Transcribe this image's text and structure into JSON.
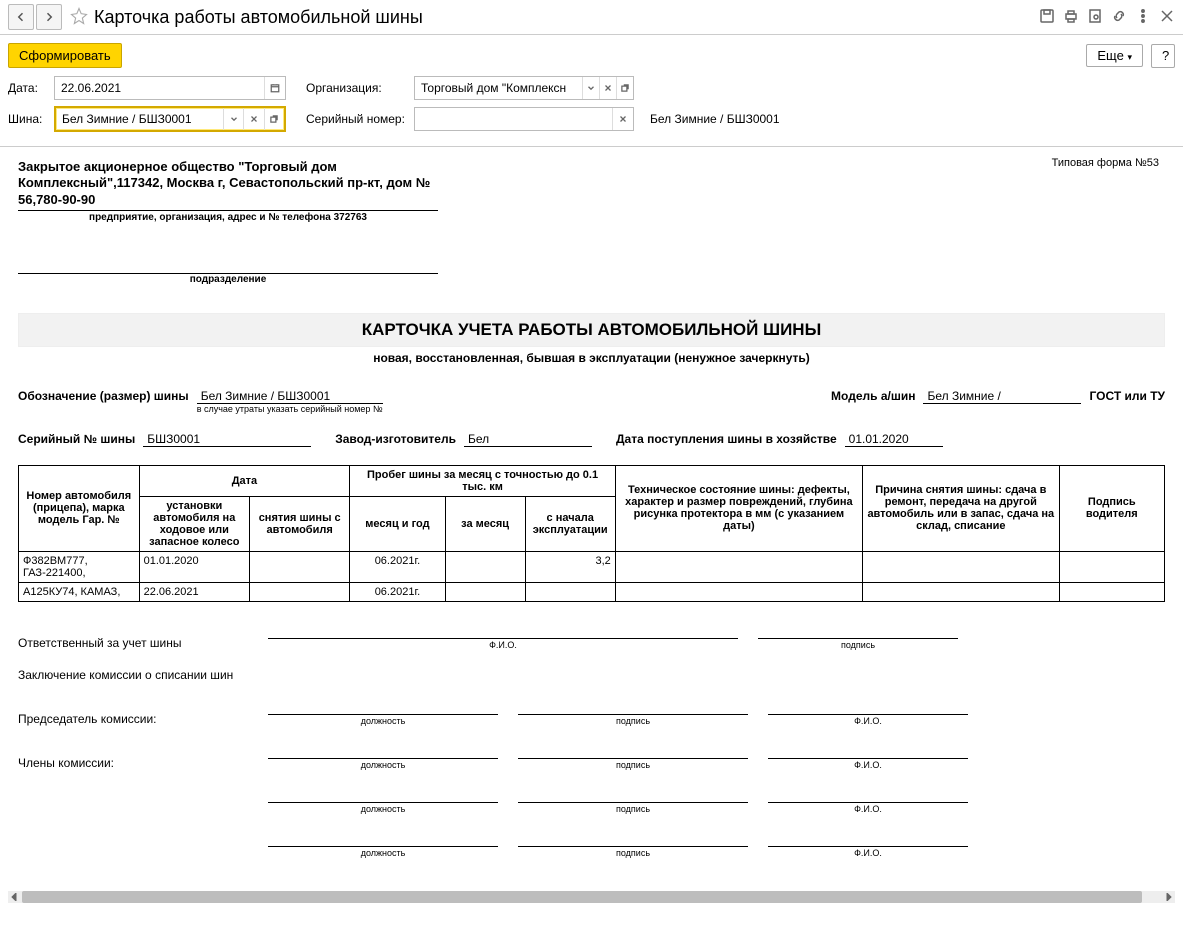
{
  "titlebar": {
    "title": "Карточка работы автомобильной шины"
  },
  "toolbar": {
    "generate": "Сформировать",
    "more": "Еще",
    "help": "?"
  },
  "params": {
    "date_label": "Дата:",
    "date_value": "22.06.2021",
    "org_label": "Организация:",
    "org_value": "Торговый дом \"Комплексн",
    "tyre_label": "Шина:",
    "tyre_value": "Бел Зимние / БШЗ0001",
    "serial_label": "Серийный номер:",
    "serial_value": "",
    "serial_display": "Бел Зимние / БШЗ0001"
  },
  "report": {
    "form_no": "Типовая форма №53",
    "org_name": "Закрытое акционерное общество \"Торговый дом Комплексный\",117342, Москва г, Севастопольский пр-кт, дом № 56,780-90-90",
    "org_sub": "предприятие, организация, адрес и № телефона 372763",
    "division_sub": "подразделение",
    "doc_title": "КАРТОЧКА УЧЕТА РАБОТЫ АВТОМОБИЛЬНОЙ ШИНЫ",
    "doc_sub": "новая, восстановленная, бывшая в эксплуатации (ненужное зачеркнуть)",
    "meta": {
      "size_label": "Обозначение (размер) шины",
      "size_value": "Бел Зимние / БШЗ0001",
      "size_note": "в случае утраты указать серийный номер №",
      "model_label": "Модель а/шин",
      "model_value": "Бел Зимние /",
      "gost_label": "ГОСТ или ТУ",
      "serial_label": "Серийный № шины",
      "serial_value": "БШЗ0001",
      "plant_label": "Завод-изготовитель",
      "plant_value": "Бел",
      "arrival_label": "Дата поступления шины в хозяйстве",
      "arrival_value": "01.01.2020"
    },
    "table": {
      "h_vehicle": "Номер автомобиля (прицепа), марка модель Гар. №",
      "h_date": "Дата",
      "h_install": "установки автомобиля на ходовое или запасное колесо",
      "h_remove": "снятия шины с автомобиля",
      "h_run": "Пробег шины за месяц с точностью до 0.1 тыс. км",
      "h_month": "месяц и год",
      "h_permonth": "за месяц",
      "h_fromstart": "с начала эксплуатации",
      "h_condition": "Техническое состояние шины: дефекты, характер и размер повреждений, глубина рисунка протектора в мм (с указанием даты)",
      "h_reason": "Причина снятия шины: сдача в ремонт, передача на другой автомобиль или в запас, сдача на склад, списание",
      "h_sign": "Подпись водителя",
      "rows": [
        {
          "vehicle": "Ф382ВМ777, ГАЗ-221400,",
          "install": "01.01.2020",
          "remove": "",
          "month": "06.2021г.",
          "permonth": "",
          "fromstart": "3,2",
          "condition": "",
          "reason": "",
          "sign": ""
        },
        {
          "vehicle": "А125КУ74, КАМАЗ,",
          "install": "22.06.2021",
          "remove": "",
          "month": "06.2021г.",
          "permonth": "",
          "fromstart": "",
          "condition": "",
          "reason": "",
          "sign": ""
        }
      ]
    },
    "sig": {
      "resp_label": "Ответственный за учет шины",
      "fio": "Ф.И.О.",
      "sign": "подпись",
      "position": "должность",
      "conclusion_label": "Заключение комиссии о списании шин",
      "chair_label": "Председатель комиссии:",
      "members_label": "Члены комиссии:"
    }
  }
}
